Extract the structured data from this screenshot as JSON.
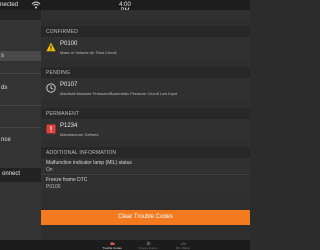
{
  "status_bar": {
    "connection": "nected",
    "time": "4:00 PM"
  },
  "sidebar": {
    "items": [
      {
        "label": "s"
      },
      {
        "label": "ds"
      },
      {
        "label": "nce"
      }
    ],
    "connect_label": "onnect"
  },
  "sections": {
    "confirmed": {
      "header": "CONFIRMED",
      "code": "P0100",
      "desc": "Mass or Volume Air Flow Circuit"
    },
    "pending": {
      "header": "PENDING",
      "code": "P0107",
      "desc": "Manifold Absolute Pressure/Barometric Pressure Circuit Low Input"
    },
    "permanent": {
      "header": "PERMANENT",
      "code": "P1234",
      "desc": "Manufacturer Defined"
    },
    "additional": {
      "header": "ADDITIONAL INFORMATION",
      "mil_label": "Malfunction indicator lamp (MIL) status",
      "mil_value": "On",
      "freeze_label": "Freeze frame DTC",
      "freeze_value": "P0100"
    }
  },
  "clear_button": {
    "label": "Clear Trouble Codes"
  },
  "tabs": [
    {
      "label": "Trouble Codes",
      "icon": "engine-icon",
      "active": true
    },
    {
      "label": "Freeze Frame",
      "icon": "snowflake-icon",
      "active": false
    },
    {
      "label": "MIL Status",
      "icon": "gauge-icon",
      "active": false
    }
  ],
  "colors": {
    "accent": "#f47a20",
    "warning": "#f2c200",
    "permanent": "#e0403a"
  }
}
